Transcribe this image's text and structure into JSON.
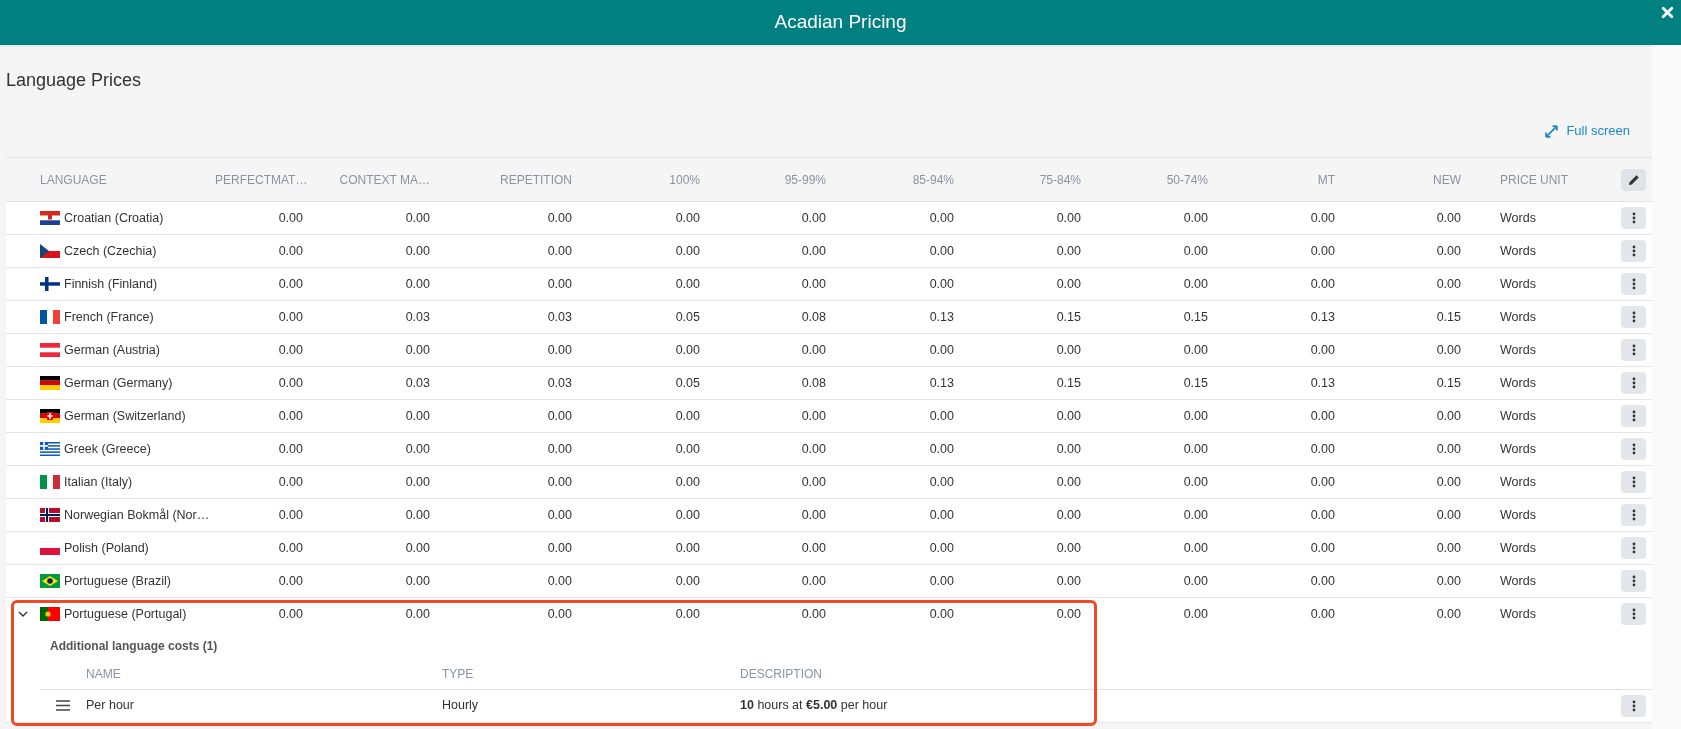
{
  "window": {
    "title": "Acadian Pricing"
  },
  "page_title": "Language Prices",
  "full_screen_link": "Full screen",
  "table": {
    "columns": [
      "LANGUAGE",
      "PERFECTMAT…",
      "CONTEXT MA…",
      "REPETITION",
      "100%",
      "95-99%",
      "85-94%",
      "75-84%",
      "50-74%",
      "MT",
      "NEW",
      "PRICE UNIT"
    ],
    "rows": [
      {
        "language": "Croatian (Croatia)",
        "values": [
          "0.00",
          "0.00",
          "0.00",
          "0.00",
          "0.00",
          "0.00",
          "0.00",
          "0.00",
          "0.00",
          "0.00"
        ],
        "unit": "Words",
        "expanded": false
      },
      {
        "language": "Czech (Czechia)",
        "values": [
          "0.00",
          "0.00",
          "0.00",
          "0.00",
          "0.00",
          "0.00",
          "0.00",
          "0.00",
          "0.00",
          "0.00"
        ],
        "unit": "Words",
        "expanded": false
      },
      {
        "language": "Finnish (Finland)",
        "values": [
          "0.00",
          "0.00",
          "0.00",
          "0.00",
          "0.00",
          "0.00",
          "0.00",
          "0.00",
          "0.00",
          "0.00"
        ],
        "unit": "Words",
        "expanded": false
      },
      {
        "language": "French (France)",
        "values": [
          "0.00",
          "0.03",
          "0.03",
          "0.05",
          "0.08",
          "0.13",
          "0.15",
          "0.15",
          "0.13",
          "0.15"
        ],
        "unit": "Words",
        "expanded": false
      },
      {
        "language": "German (Austria)",
        "values": [
          "0.00",
          "0.00",
          "0.00",
          "0.00",
          "0.00",
          "0.00",
          "0.00",
          "0.00",
          "0.00",
          "0.00"
        ],
        "unit": "Words",
        "expanded": false
      },
      {
        "language": "German (Germany)",
        "values": [
          "0.00",
          "0.03",
          "0.03",
          "0.05",
          "0.08",
          "0.13",
          "0.15",
          "0.15",
          "0.13",
          "0.15"
        ],
        "unit": "Words",
        "expanded": false
      },
      {
        "language": "German (Switzerland)",
        "values": [
          "0.00",
          "0.00",
          "0.00",
          "0.00",
          "0.00",
          "0.00",
          "0.00",
          "0.00",
          "0.00",
          "0.00"
        ],
        "unit": "Words",
        "expanded": false
      },
      {
        "language": "Greek (Greece)",
        "values": [
          "0.00",
          "0.00",
          "0.00",
          "0.00",
          "0.00",
          "0.00",
          "0.00",
          "0.00",
          "0.00",
          "0.00"
        ],
        "unit": "Words",
        "expanded": false
      },
      {
        "language": "Italian (Italy)",
        "values": [
          "0.00",
          "0.00",
          "0.00",
          "0.00",
          "0.00",
          "0.00",
          "0.00",
          "0.00",
          "0.00",
          "0.00"
        ],
        "unit": "Words",
        "expanded": false
      },
      {
        "language": "Norwegian Bokmål (Nor…",
        "values": [
          "0.00",
          "0.00",
          "0.00",
          "0.00",
          "0.00",
          "0.00",
          "0.00",
          "0.00",
          "0.00",
          "0.00"
        ],
        "unit": "Words",
        "expanded": false
      },
      {
        "language": "Polish (Poland)",
        "values": [
          "0.00",
          "0.00",
          "0.00",
          "0.00",
          "0.00",
          "0.00",
          "0.00",
          "0.00",
          "0.00",
          "0.00"
        ],
        "unit": "Words",
        "expanded": false
      },
      {
        "language": "Portuguese (Brazil)",
        "values": [
          "0.00",
          "0.00",
          "0.00",
          "0.00",
          "0.00",
          "0.00",
          "0.00",
          "0.00",
          "0.00",
          "0.00"
        ],
        "unit": "Words",
        "expanded": false
      },
      {
        "language": "Portuguese (Portugal)",
        "values": [
          "0.00",
          "0.00",
          "0.00",
          "0.00",
          "0.00",
          "0.00",
          "0.00",
          "0.00",
          "0.00",
          "0.00"
        ],
        "unit": "Words",
        "expanded": true,
        "additional_costs": {
          "title": "Additional language costs (1)",
          "columns": [
            "NAME",
            "TYPE",
            "DESCRIPTION"
          ],
          "rows": [
            {
              "name": "Per hour",
              "type": "Hourly",
              "description": "**10** hours at **€5.00** per hour"
            }
          ]
        }
      }
    ]
  }
}
